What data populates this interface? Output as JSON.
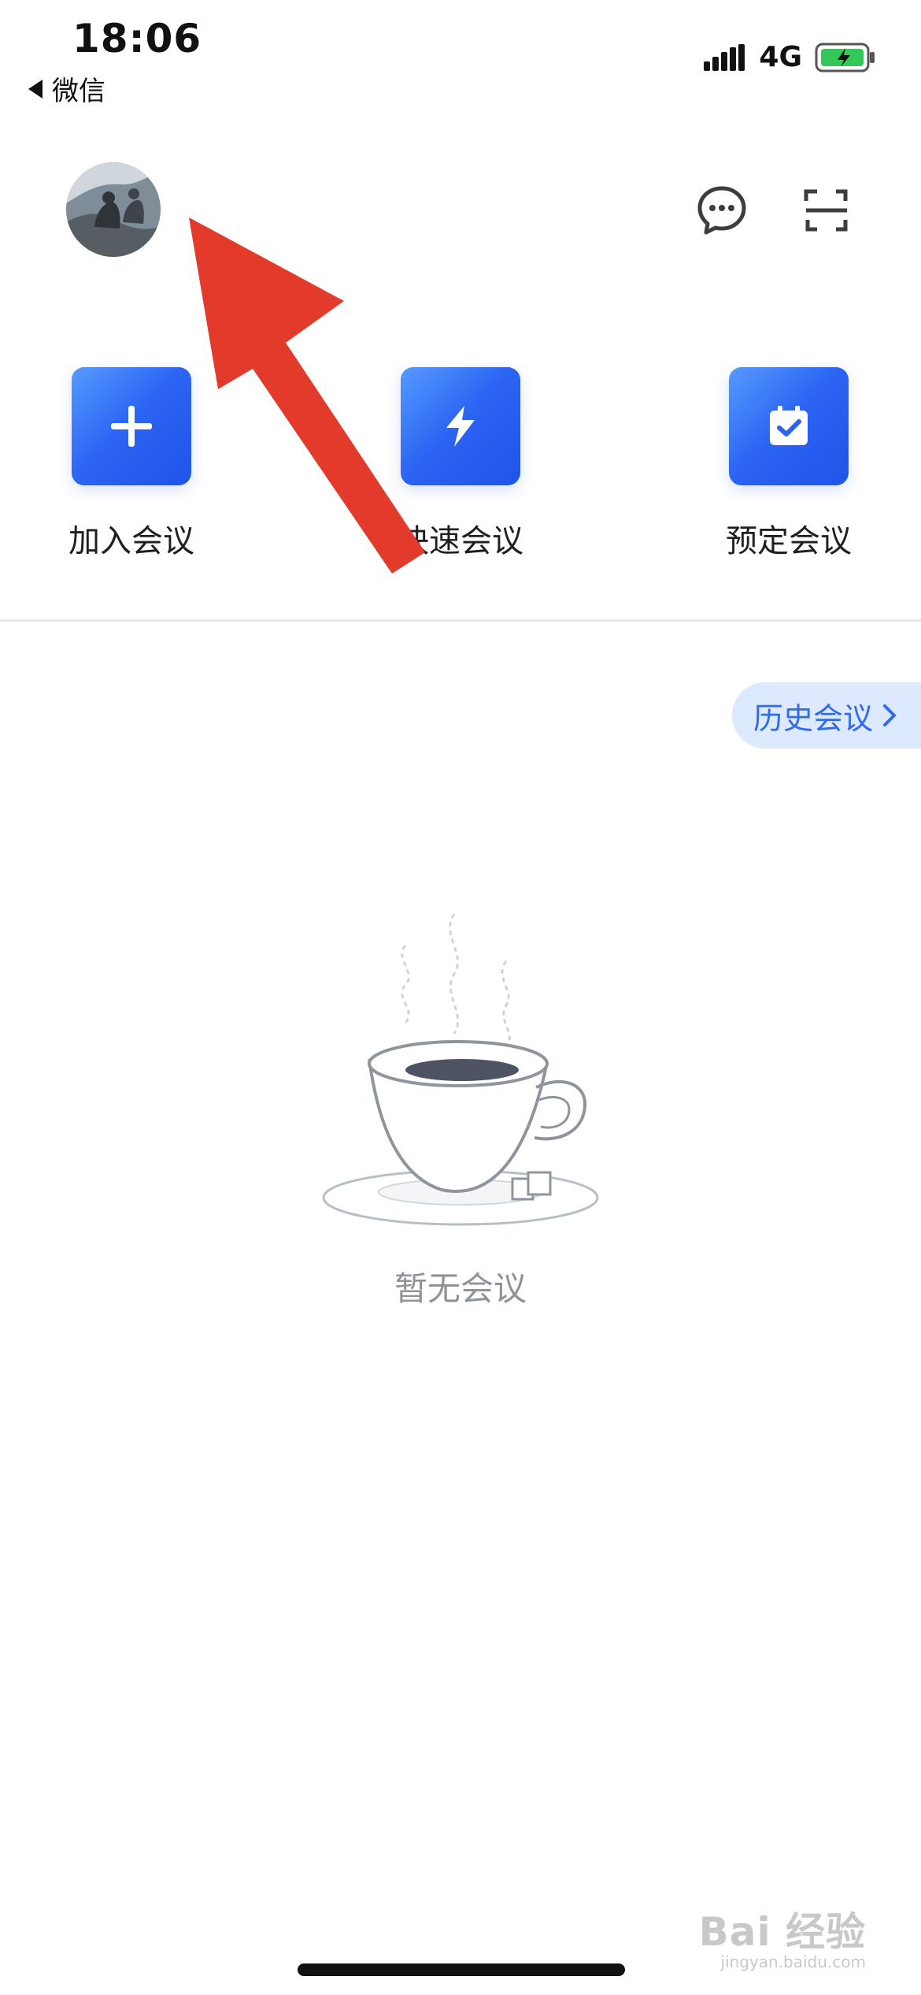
{
  "status_bar": {
    "time": "18:06",
    "back_label": "微信",
    "network": "4G"
  },
  "header": {
    "avatar_icon": "user-avatar",
    "chat_icon": "chat-bubble-icon",
    "scan_icon": "scan-icon"
  },
  "actions": [
    {
      "label": "加入会议",
      "icon": "plus-icon"
    },
    {
      "label": "快速会议",
      "icon": "lightning-icon"
    },
    {
      "label": "预定会议",
      "icon": "calendar-check-icon"
    }
  ],
  "history": {
    "label": "历史会议"
  },
  "empty_state": {
    "text": "暂无会议",
    "illustration_icon": "coffee-cup-icon"
  },
  "watermark": {
    "main": "Bai 经验",
    "sub": "jingyan.baidu.com"
  },
  "colors": {
    "accent": "#2f6bee",
    "tile_blue": "#2b63f3",
    "annotation_red": "#e23b2b"
  }
}
